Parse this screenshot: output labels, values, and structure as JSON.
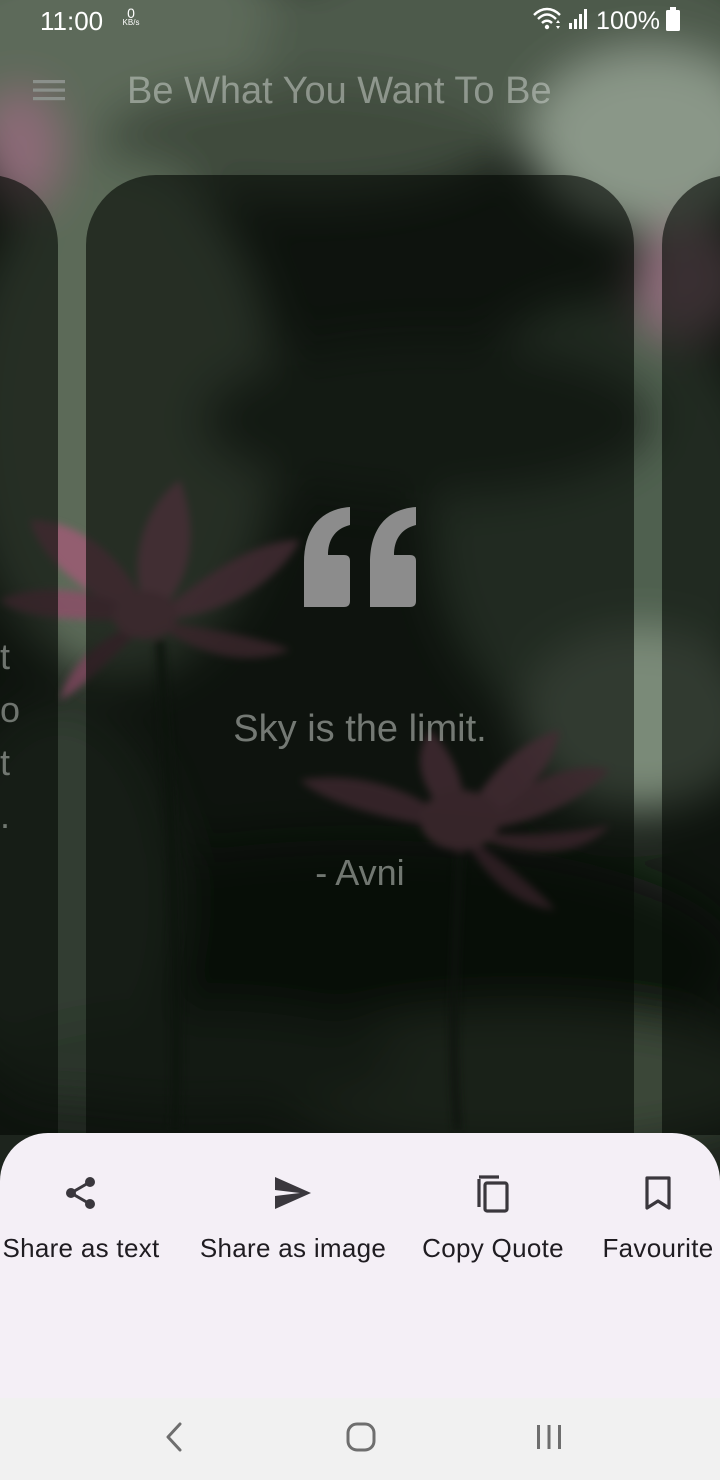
{
  "status_bar": {
    "time": "11:00",
    "net_speed_value": "0",
    "net_speed_unit": "KB/s",
    "battery": "100%"
  },
  "app_bar": {
    "title": "Be What You Want To Be",
    "menu_icon": "hamburger-menu-icon"
  },
  "quote_card": {
    "text": "Sky is the limit.",
    "author": "- Avni",
    "icon": "format-quote-icon"
  },
  "adjacent_card_fragments": [
    "t",
    "o",
    "t",
    "."
  ],
  "bottom_sheet": {
    "actions": [
      {
        "label": "Share as text",
        "icon": "share-icon"
      },
      {
        "label": "Share as image",
        "icon": "send-icon"
      },
      {
        "label": "Copy Quote",
        "icon": "copy-icon"
      },
      {
        "label": "Favourite",
        "icon": "bookmark-icon"
      }
    ]
  },
  "nav_bar": {
    "back_icon": "back-chevron-icon",
    "home_icon": "home-icon",
    "recents_icon": "recent-apps-icon"
  },
  "colors": {
    "sheet_background": "#f4eff6",
    "sheet_text": "#1f1c21",
    "nav_background": "#f1f1f1",
    "dim_text": "#9ca09c"
  }
}
